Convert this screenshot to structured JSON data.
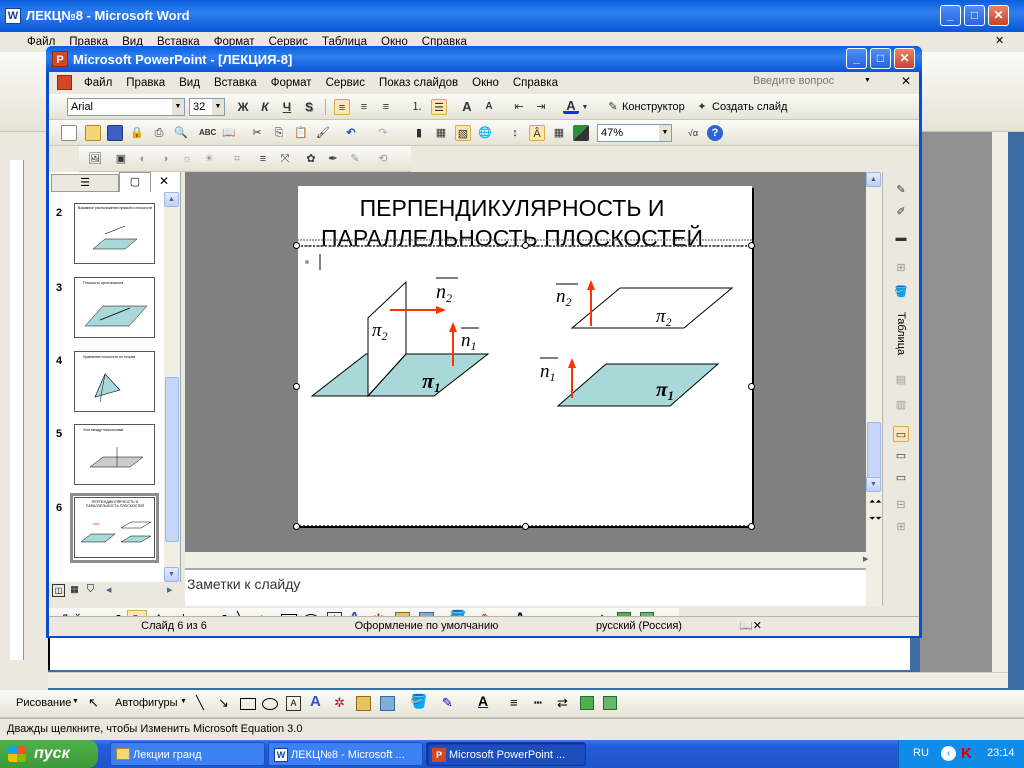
{
  "word": {
    "title": "ЛЕКЦ№8 - Microsoft Word",
    "menu": [
      "Файл",
      "Правка",
      "Вид",
      "Вставка",
      "Формат",
      "Сервис",
      "Таблица",
      "Окно",
      "Справка"
    ],
    "statusbar": "Дважды щелкните, чтобы Изменить Microsoft Equation 3.0",
    "drawing_toolbar": {
      "draw_label": "Рисование",
      "autoshapes_label": "Автофигуры"
    }
  },
  "ppt": {
    "title": "Microsoft PowerPoint - [ЛЕКЦИЯ-8]",
    "menu": [
      "Файл",
      "Правка",
      "Вид",
      "Вставка",
      "Формат",
      "Сервис",
      "Показ слайдов",
      "Окно",
      "Справка"
    ],
    "help_placeholder": "Введите вопрос",
    "font": "Arial",
    "font_size": "32",
    "designer_label": "Конструктор",
    "new_slide_label": "Создать слайд",
    "zoom": "47%",
    "slides": [
      {
        "num": "2",
        "title": "Взаимное расположение прямой и плоскости"
      },
      {
        "num": "3",
        "title": "Плоскость ортогональна"
      },
      {
        "num": "4",
        "title": "Уравнение плоскости по точкам"
      },
      {
        "num": "5",
        "title": "Угол между плоскостями"
      },
      {
        "num": "6",
        "title": "ПЕРПЕНДИКУЛЯРНОСТЬ И ПАРАЛЛЕЛЬНОСТЬ ПЛОСКОСТЕЙ"
      }
    ],
    "slide": {
      "title_line1": "ПЕРПЕНДИКУЛЯРНОСТЬ И",
      "title_line2": "ПАРАЛЛЕЛЬНОСТЬ ПЛОСКОСТЕЙ",
      "n_letter": "n",
      "pi_letter": "π",
      "sub1": "1",
      "sub2": "2"
    },
    "notes_placeholder": "Заметки к слайду",
    "drawing_toolbar": {
      "actions_label": "Действия",
      "autoshapes_label": "Автофигуры"
    },
    "status": {
      "slide": "Слайд 6 из 6",
      "design": "Оформление по умолчанию",
      "language": "русский (Россия)"
    },
    "task_pane_label": "Таблица"
  },
  "taskbar": {
    "start_label": "пуск",
    "items": [
      "Лекции гранд",
      "ЛЕКЦ№8 - Microsoft ...",
      "Microsoft PowerPoint ..."
    ],
    "lang": "RU",
    "clock": "23:14"
  },
  "colors": {
    "plane_fill": "#a9d8d8",
    "arrow": "#ff3300",
    "xp_blue": "#245edb",
    "taskbar": "#245edb"
  }
}
